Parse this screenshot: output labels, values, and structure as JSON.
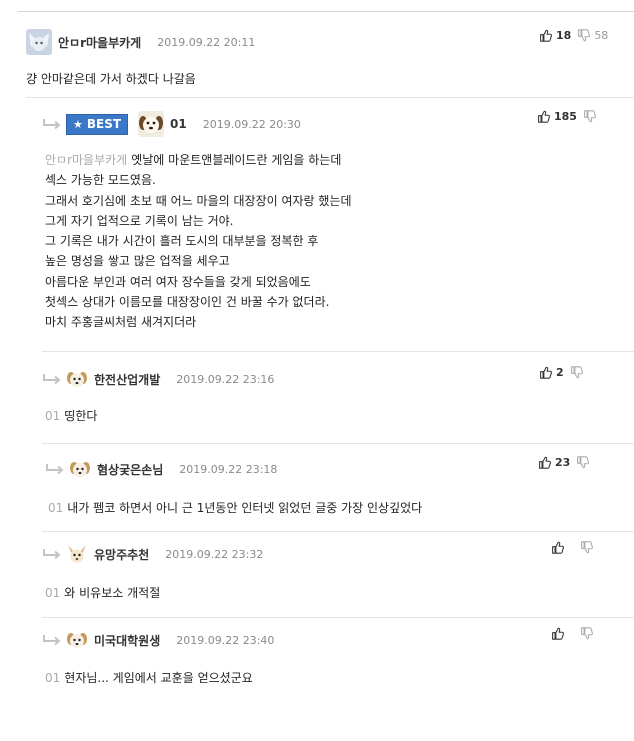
{
  "comments": [
    {
      "author": "안ㅁr마을부카게",
      "date": "2019.09.22 20:11",
      "up": "18",
      "down": "58",
      "text": "걍 안마같은데 가서 하겠다 나갈음"
    },
    {
      "badge": "BEST",
      "author": "01",
      "date": "2019.09.22 20:30",
      "up": "185",
      "down": "",
      "mention": "안ㅁr마을부카게",
      "lines": [
        "옛날에 마운트앤블레이드란 게임을 하는데",
        "섹스 가능한 모드였음.",
        "그래서 호기심에 초보 때 어느 마을의 대장장이 여자랑 했는데",
        "그게 자기 업적으로 기록이 남는 거야.",
        "그 기록은 내가 시간이 흘러 도시의 대부분을 정복한 후",
        "높은 명성을 쌓고 많은 업적을 세우고",
        "아름다운 부인과 여러 여자 장수들을 갖게 되었음에도",
        "첫섹스 상대가 이름모를 대장장이인 건 바꿀 수가 없더라.",
        "마치 주홍글씨처럼 새겨지더라"
      ]
    },
    {
      "author": "한전산업개발",
      "date": "2019.09.22 23:16",
      "up": "2",
      "down": "",
      "mention": "01",
      "text": "띵한다"
    },
    {
      "author": "혐상궂은손님",
      "date": "2019.09.22 23:18",
      "up": "23",
      "down": "",
      "mention": "01",
      "text": "내가 펨코 하면서 아니 근 1년동안 인터넷 읽었던 글중 가장 인상깊었다"
    },
    {
      "author": "유망주추천",
      "date": "2019.09.22 23:32",
      "up": "",
      "down": "",
      "mention": "01",
      "text": "와 비유보소 개적절"
    },
    {
      "author": "미국대학원생",
      "date": "2019.09.22 23:40",
      "up": "",
      "down": "",
      "mention": "01",
      "text": "현자님... 게임에서 교훈을 얻으셨군요"
    }
  ],
  "colors": {
    "best_badge": "#3b78c8",
    "date": "#8a8a8a",
    "mention": "#aaaaaa"
  },
  "icons": [
    "thumbs-up-icon",
    "thumbs-down-icon",
    "reply-arrow-icon",
    "star-icon"
  ]
}
